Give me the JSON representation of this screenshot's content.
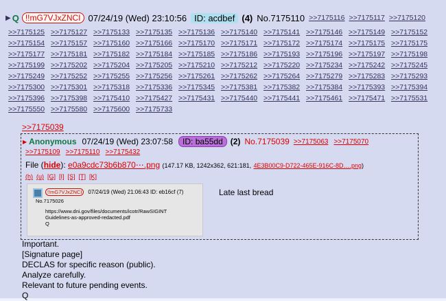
{
  "post": {
    "q_label": "Q",
    "tripcode": "!!mG7VJxZNCI",
    "date": "07/24/19 (Wed) 23:10:56",
    "id": "ID: acdbef",
    "count": "(4)",
    "number": "No.7175110",
    "replies": [
      ">>7175116",
      ">>7175117",
      ">>7175120",
      ">>7175125",
      ">>7175127",
      ">>7175133",
      ">>7175135",
      ">>7175136",
      ">>7175140",
      ">>7175141",
      ">>7175146",
      ">>7175149",
      ">>7175152",
      ">>7175154",
      ">>7175157",
      ">>7175160",
      ">>7175166",
      ">>7175170",
      ">>7175171",
      ">>7175172",
      ">>7175174",
      ">>7175175",
      ">>7175175",
      ">>7175177",
      ">>7175181",
      ">>7175182",
      ">>7175184",
      ">>7175185",
      ">>7175186",
      ">>7175193",
      ">>7175196",
      ">>7175197",
      ">>7175198",
      ">>7175199",
      ">>7175202",
      ">>7175204",
      ">>7175205",
      ">>7175210",
      ">>7175212",
      ">>7175220",
      ">>7175234",
      ">>7175242",
      ">>7175245",
      ">>7175249",
      ">>7175252",
      ">>7175255",
      ">>7175256",
      ">>7175261",
      ">>7175262",
      ">>7175264",
      ">>7175279",
      ">>7175283",
      ">>7175293",
      ">>7175300",
      ">>7175301",
      ">>7175318",
      ">>7175336",
      ">>7175345",
      ">>7175381",
      ">>7175382",
      ">>7175384",
      ">>7175393",
      ">>7175394",
      ">>7175396",
      ">>7175398",
      ">>7175410",
      ">>7175427",
      ">>7175431",
      ">>7175440",
      ">>7175441",
      ">>7175461",
      ">>7175471",
      ">>7175531",
      ">>7175550",
      ">>7175580",
      ">>7175600",
      ">>7175733"
    ],
    "quote_link": ">>7175039",
    "body": [
      "Important.",
      "[Signature page]",
      "DECLAS for specific reason (public).",
      "Analyze carefully.",
      "Relevant to future pending events.",
      "Q"
    ]
  },
  "quoted": {
    "name": "Anonymous",
    "date": "07/24/19 (Wed) 23:07:58",
    "id": "ID: ba55dd",
    "count": "(2)",
    "number": "No.7175039",
    "replies": [
      ">>7175063",
      ">>7175070",
      ">>7175109",
      ">>7175110",
      ">>7175432"
    ],
    "file_label": "File",
    "hide_label": "hide",
    "filename": "e0a9cdc73b6b870⋯.png",
    "file_meta": "(147.17 KB, 1242x362, 621:181,",
    "orig_name": "4E3B00C9-D722-465E-916C-8D….png",
    "tools": [
      "(h)",
      "(u)",
      "[G]",
      "[I]",
      "[S]",
      "[T]",
      "[K]"
    ],
    "message": "Late last bread",
    "thumb": {
      "tripcode": "!!mG7VJxZNCI",
      "header": "07/24/19 (Wed) 21:06:43 ID: eb16cf (7)",
      "number": "No.7175026",
      "text": "https://www.dni.gov/files/documents/icotr/RawSIGINT\nGuidelines-as-approved-redacted.pdf\nQ"
    }
  }
}
